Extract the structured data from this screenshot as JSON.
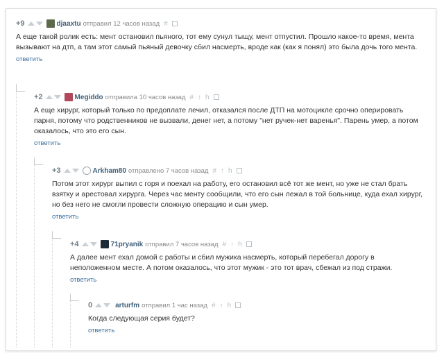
{
  "comments": [
    {
      "rating": "+9",
      "author": "djaaxtu",
      "meta": "отправил 12 часов назад",
      "text": "А еще такой ролик есть: мент остановил пьяного, тот ему сунул тыщу, мент отпустил. Прошло какое-то время, мента вызывают на дтп, а там этот самый пьяный девочку сбил насмерть, вроде как (как я понял) это была дочь того мента.",
      "reply": "ответить",
      "avatar_color": "#5a6a4a"
    },
    {
      "rating": "+2",
      "author": "Megiddo",
      "meta": "отправила 10 часов назад",
      "text": "А еще хирург, который только по предоплате лечил, отказался после ДТП на мотоцикле срочно оперировать парня, потому что родственников не вызвали, денег нет, а потому \"нет ручек-нет варенья\". Парень умер, а потом оказалось, что это его сын.",
      "reply": "ответить",
      "avatar_color": "#b04a5a"
    },
    {
      "rating": "+3",
      "author": "Arkham80",
      "meta": "отправлено 7 часов назад",
      "text": "Потом этот хирург выпил с горя и поехал на работу, его остановил всё тот же мент, но уже не стал брать взятку и арестовал хирурга. Через час менту сообщили, что его сын лежал в той больнице, куда ехал хирург, но без него не смогли провести сложную операцию и сын умер.",
      "reply": "ответить",
      "avatar_color": "#ffffff"
    },
    {
      "rating": "+4",
      "author": "71pryanik",
      "meta": "отправил 7 часов назад",
      "text": "А далее мент ехал домой с работы и сбил мужика насмерть, который перебегал дорогу в неположенном месте. А потом оказалось, что этот мужик - это тот врач, сбежал из под стражи.",
      "reply": "ответить",
      "avatar_color": "#1e2a36"
    },
    {
      "rating": "0",
      "author": "arturfm",
      "meta": "отправил 1 час назад",
      "text": "Когда следующая серия будет?",
      "reply": "ответить",
      "avatar_color": ""
    }
  ]
}
